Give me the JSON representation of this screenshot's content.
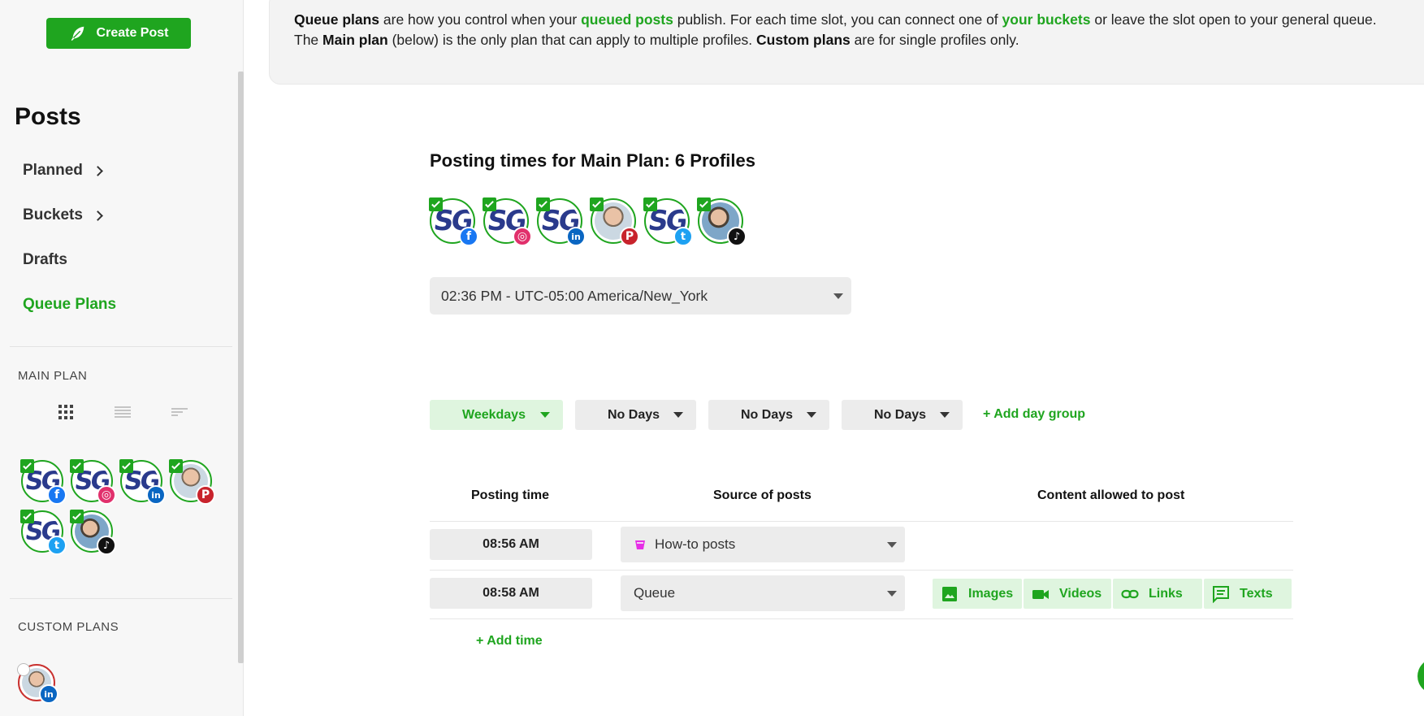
{
  "sidebar": {
    "create_post_label": "Create Post",
    "title": "Posts",
    "nav": [
      "Planned",
      "Buckets",
      "Drafts",
      "Queue Plans"
    ],
    "main_plan_label": "MAIN PLAN",
    "custom_plans_label": "CUSTOM PLANS",
    "view_modes": [
      "grid-icon",
      "list-icon",
      "compact-list-icon"
    ],
    "main_plan_profiles": [
      {
        "type": "logo",
        "logo_text": "SG",
        "network": "facebook",
        "network_glyph": "f",
        "checked": true
      },
      {
        "type": "logo",
        "logo_text": "SG",
        "network": "instagram",
        "network_glyph": "◎",
        "checked": true
      },
      {
        "type": "logo",
        "logo_text": "SG",
        "network": "linkedin",
        "network_glyph": "in",
        "checked": true
      },
      {
        "type": "photo",
        "network": "pinterest",
        "network_glyph": "P",
        "checked": true
      },
      {
        "type": "logo",
        "logo_text": "SG",
        "network": "twitter",
        "network_glyph": "t",
        "checked": true
      },
      {
        "type": "photo",
        "network": "tiktok",
        "network_glyph": "♪",
        "checked": true
      }
    ],
    "custom_plan_profiles": [
      {
        "type": "photo",
        "network": "linkedin",
        "network_glyph": "in",
        "checked": false
      }
    ]
  },
  "info": {
    "p1_b1": "Queue plans",
    "p1_t1": " are how you control when your ",
    "p1_g1": "queued posts",
    "p1_t2": " publish. For each time slot, you can connect one of ",
    "p1_g2": "your buckets",
    "p1_t3": " or leave the slot open to your general queue.",
    "p2_t1": "The ",
    "p2_b1": "Main plan",
    "p2_t2": " (below) is the only plan that can apply to multiple profiles. ",
    "p2_b2": "Custom plans",
    "p2_t3": " are for single profiles only."
  },
  "main": {
    "title": "Posting times for  Main Plan: 6 Profiles",
    "timezone": "02:36 PM - UTC-05:00 America/New_York",
    "day_groups": [
      "Weekdays",
      "No Days",
      "No Days",
      "No Days"
    ],
    "add_day_group": "+ Add day group",
    "columns": [
      "Posting time",
      "Source of posts",
      "Content allowed to post"
    ],
    "slots": [
      {
        "time": "08:56 AM",
        "source": "How-to posts",
        "source_icon": "bucket-icon"
      },
      {
        "time": "08:58 AM",
        "source": "Queue",
        "source_icon": ""
      }
    ],
    "content_types": [
      "Images",
      "Videos",
      "Links",
      "Texts"
    ],
    "add_time": "+ Add time"
  },
  "colors": {
    "accent": "#1fa51f",
    "accent_light": "#dff5df",
    "logo_blue": "#2a3a8c",
    "bucket_pink": "#e62ee6"
  }
}
